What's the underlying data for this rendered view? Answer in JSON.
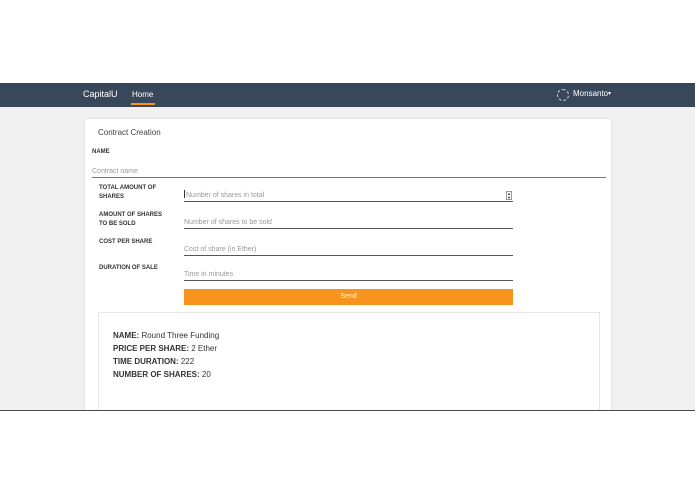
{
  "navbar": {
    "brand": "CapitalU",
    "home": "Home",
    "user": "Monsanto",
    "user_caret": "▾"
  },
  "form": {
    "title": "Contract Creation",
    "name_label": "NAME",
    "name_placeholder": "Contract name",
    "fields": [
      {
        "label_line1": "TOTAL AMOUNT OF",
        "label_line2": "SHARES",
        "placeholder": "Number of shares in total"
      },
      {
        "label_line1": "AMOUNT OF SHARES",
        "label_line2": "TO BE SOLD",
        "placeholder": "Number of shares to be sold"
      },
      {
        "label_line1": "COST PER SHARE",
        "label_line2": "",
        "placeholder": "Cost of share (in Ether)"
      },
      {
        "label_line1": "DURATION OF SALE",
        "label_line2": "",
        "placeholder": "Time in minutes"
      }
    ],
    "send_label": "Send"
  },
  "summary": {
    "name_label": "NAME:",
    "name_value": "Round Three Funding",
    "price_label": "PRICE PER SHARE:",
    "price_value": "2 Ether",
    "duration_label": "TIME DURATION:",
    "duration_value": "222",
    "shares_label": "NUMBER OF SHARES:",
    "shares_value": "20"
  },
  "colors": {
    "navbar": "#38485a",
    "accent": "#f7941d",
    "background": "#f0f0f0"
  }
}
